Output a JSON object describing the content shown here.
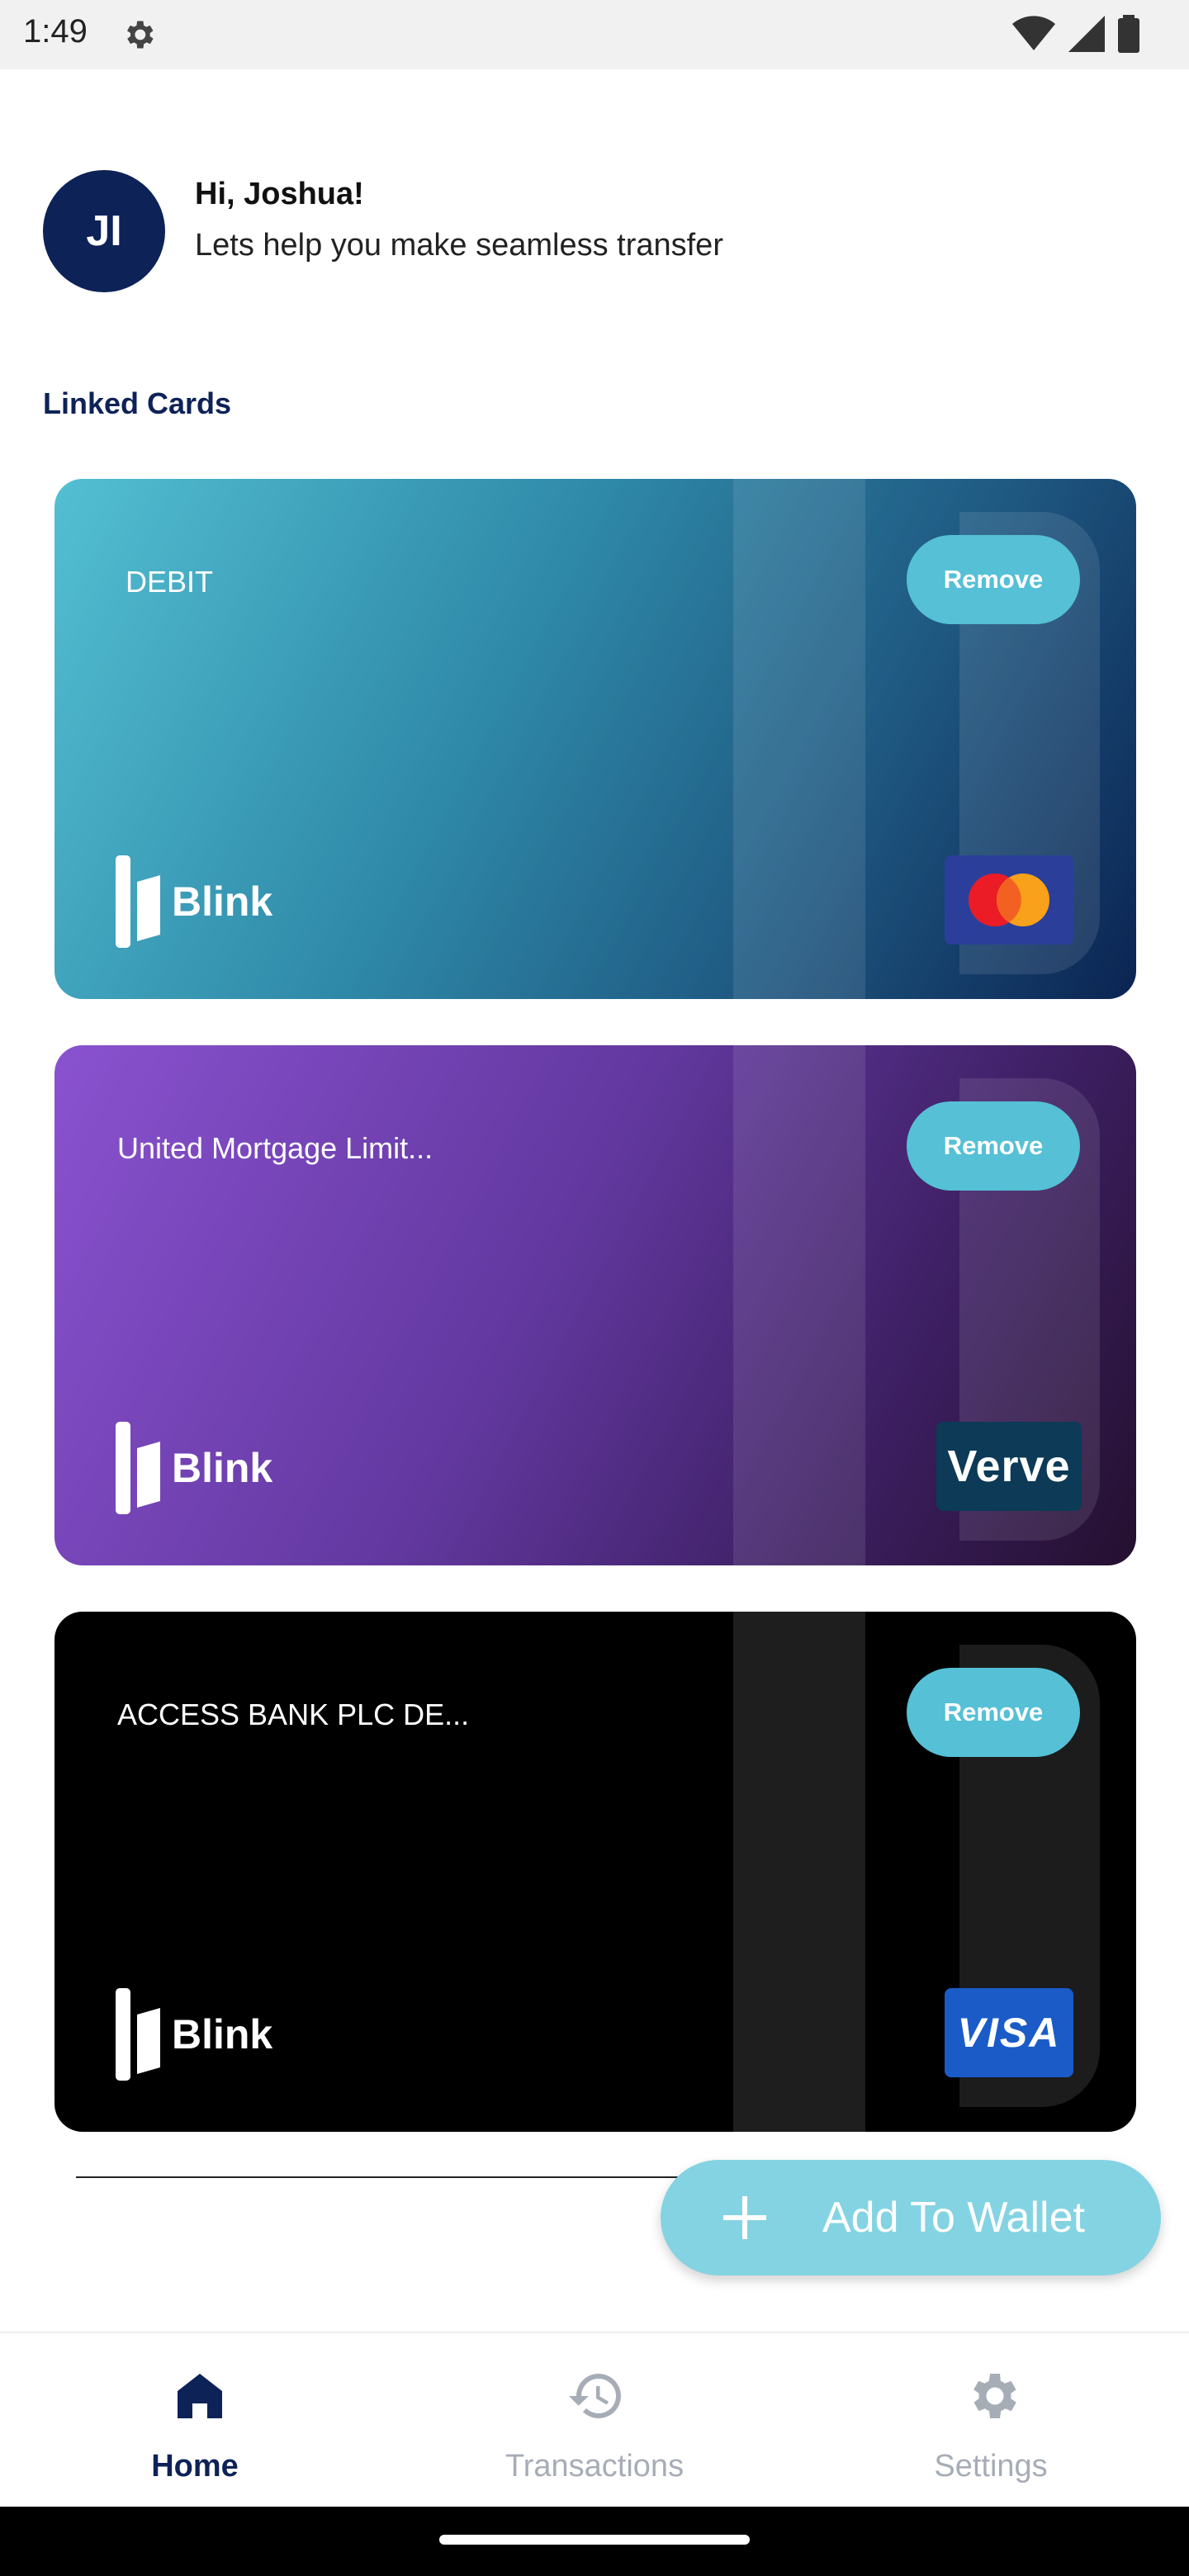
{
  "status_bar": {
    "time": "1:49"
  },
  "greeting": {
    "initials": "JI",
    "name": "Hi, Joshua!",
    "subtitle": "Lets help you make seamless transfer"
  },
  "linked_cards": {
    "title": "Linked Cards",
    "cards": [
      {
        "name": "DEBIT",
        "remove_label": "Remove",
        "logo": "Blink",
        "network": "mastercard",
        "colors": [
          "#53bfd2",
          "#0b2452"
        ]
      },
      {
        "name": "United Mortgage Limit...",
        "remove_label": "Remove",
        "logo": "Blink",
        "network": "verve",
        "network_text": "Verve",
        "colors": [
          "#8a52d0",
          "#24102f"
        ]
      },
      {
        "name": "ACCESS BANK PLC DE...",
        "remove_label": "Remove",
        "logo": "Blink",
        "network": "visa",
        "network_text": "VISA",
        "colors": [
          "#000000",
          "#1e1e1e"
        ]
      }
    ]
  },
  "fab": {
    "label": "Add To Wallet",
    "icon": "plus-icon",
    "color": "#84d3e3"
  },
  "bottom_nav": {
    "items": [
      {
        "label": "Home",
        "icon": "home-icon",
        "active": true
      },
      {
        "label": "Transactions",
        "icon": "history-icon",
        "active": false
      },
      {
        "label": "Settings",
        "icon": "gear-icon",
        "active": false
      }
    ]
  },
  "colors": {
    "primary": "#0d2257",
    "accent": "#55c0d6",
    "inactive": "#a6adb7"
  }
}
